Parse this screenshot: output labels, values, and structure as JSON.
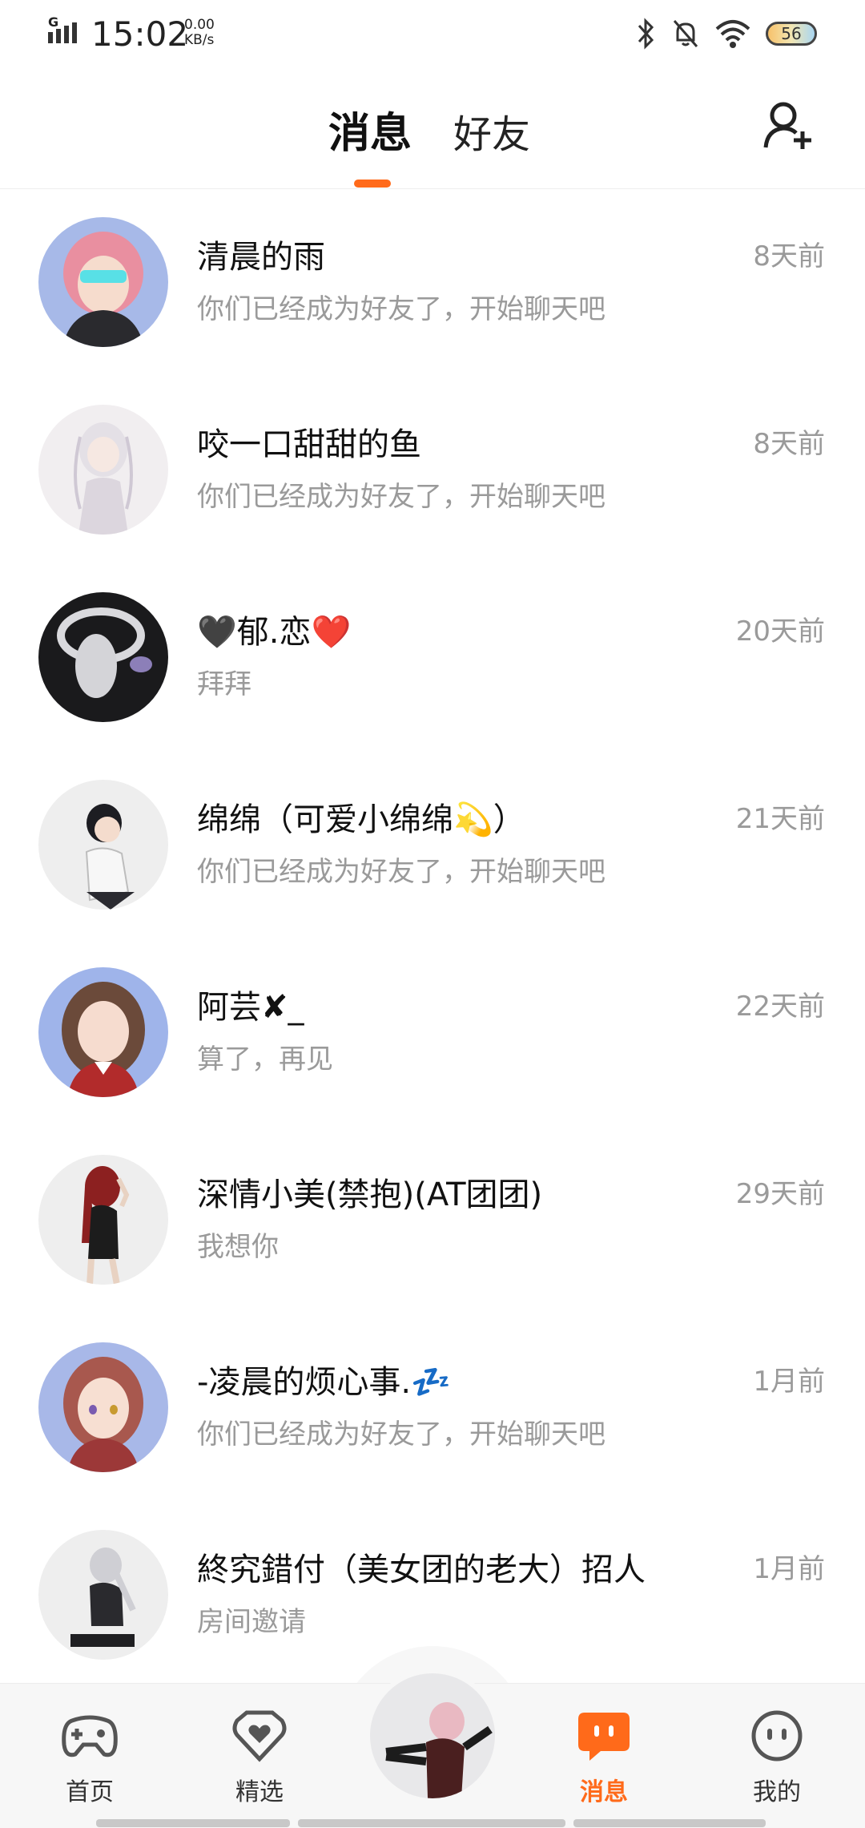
{
  "status_bar": {
    "network": "G",
    "time": "15:02",
    "speed_value": "0.00",
    "speed_unit": "KB/s",
    "battery": "56"
  },
  "header": {
    "tabs": [
      {
        "label": "消息",
        "active": true
      },
      {
        "label": "好友",
        "active": false
      }
    ],
    "accent_color": "#ff6a1a"
  },
  "messages": [
    {
      "name": "清晨的雨",
      "preview": "你们已经成为好友了，开始聊天吧",
      "time": "8天前"
    },
    {
      "name": "咬一口甜甜的鱼",
      "preview": "你们已经成为好友了，开始聊天吧",
      "time": "8天前"
    },
    {
      "name": "🖤郁.恋❤️",
      "preview": "拜拜",
      "time": "20天前"
    },
    {
      "name": "绵绵（可爱小绵绵💫）",
      "preview": "你们已经成为好友了，开始聊天吧",
      "time": "21天前"
    },
    {
      "name": "阿芸✘_",
      "preview": "算了，再见",
      "time": "22天前"
    },
    {
      "name": "深情小美(禁抱)(AT团团)",
      "preview": "我想你",
      "time": "29天前"
    },
    {
      "name": "-凌晨的烦心事.💤",
      "preview": "你们已经成为好友了，开始聊天吧",
      "time": "1月前"
    },
    {
      "name": "終究錯付（美女团的老大）招人",
      "preview": "房间邀请",
      "time": "1月前"
    }
  ],
  "bottom_nav": {
    "items": [
      {
        "label": "首页",
        "icon": "gamepad-icon"
      },
      {
        "label": "精选",
        "icon": "heart-shield-icon"
      },
      {
        "label": "消息",
        "icon": "chat-bubble-icon",
        "active": true
      },
      {
        "label": "我的",
        "icon": "smiley-face-icon"
      }
    ]
  }
}
